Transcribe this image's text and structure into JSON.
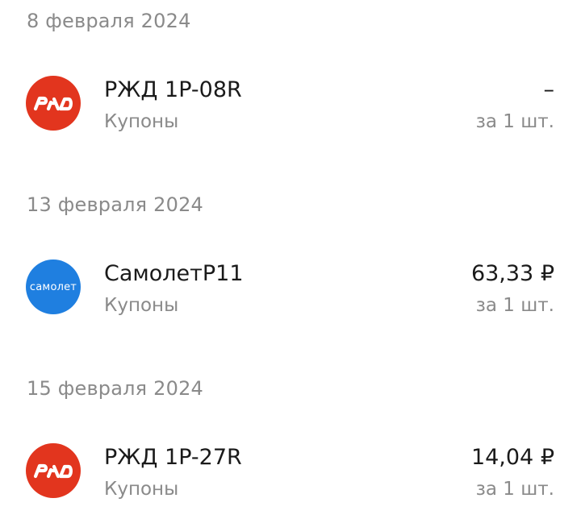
{
  "entries": [
    {
      "date": "8 февраля 2024",
      "name": "РЖД 1P-08R",
      "type": "Купоны",
      "amount": "–",
      "unit": "за 1 шт.",
      "logo": "rzd-logo",
      "logo_color": "#e2351e"
    },
    {
      "date": "13 февраля 2024",
      "name": "СамолетР11",
      "type": "Купоны",
      "amount": "63,33 ₽",
      "unit": "за 1 шт.",
      "logo": "samolet-logo",
      "logo_text": "самолет",
      "logo_color": "#1f7fe0"
    },
    {
      "date": "15 февраля 2024",
      "name": "РЖД 1P-27R",
      "type": "Купоны",
      "amount": "14,04 ₽",
      "unit": "за 1 шт.",
      "logo": "rzd-logo",
      "logo_color": "#e2351e"
    }
  ]
}
